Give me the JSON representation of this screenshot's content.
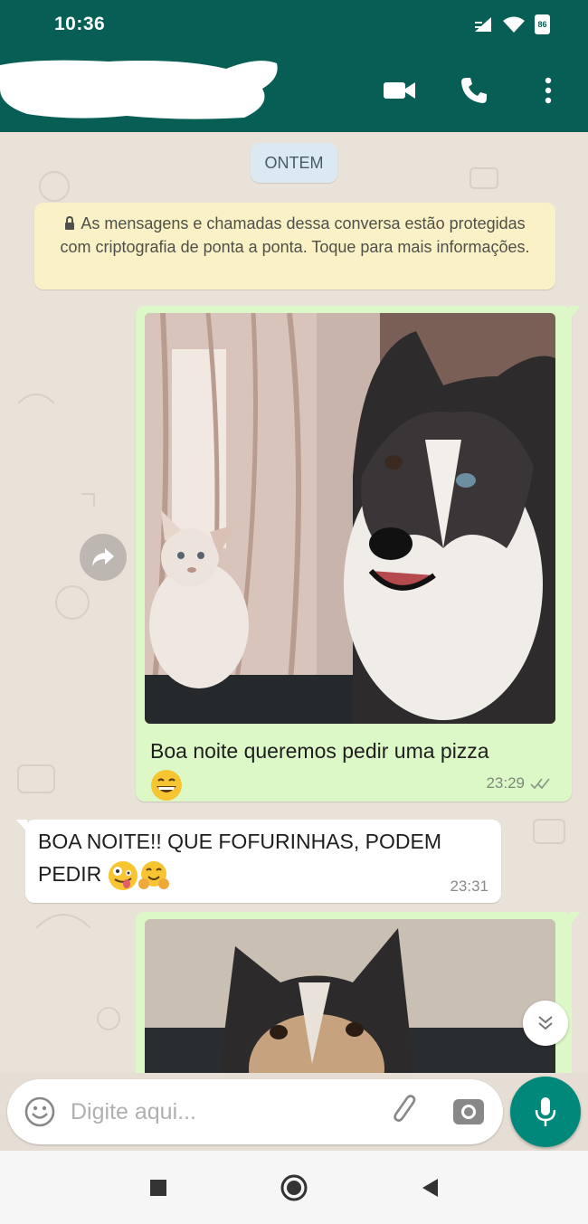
{
  "status_bar": {
    "time": "10:36",
    "battery": "86"
  },
  "chat": {
    "date_chip": "ONTEM",
    "encryption_notice": "As mensagens e chamadas dessa conversa estão protegidas com criptografia de ponta a ponta. Toque para mais informações.",
    "messages": [
      {
        "direction": "outgoing",
        "type": "image",
        "caption": "Boa noite queremos pedir uma pizza",
        "emoji": "grinning-face",
        "time": "23:29",
        "status": "read"
      },
      {
        "direction": "incoming",
        "type": "text",
        "line1": "BOA NOITE!! QUE FOFURINHAS, PODEM",
        "line2": "PEDIR",
        "emoji": [
          "zany-face",
          "hugging-face"
        ],
        "time": "23:31"
      },
      {
        "direction": "outgoing",
        "type": "image"
      }
    ]
  },
  "composer": {
    "placeholder": "Digite aqui..."
  },
  "colors": {
    "header": "#075e54",
    "outgoing": "#dcf8c6",
    "accent": "#00897b",
    "chip": "#dbeaf2",
    "notice": "#fbf1c6"
  }
}
